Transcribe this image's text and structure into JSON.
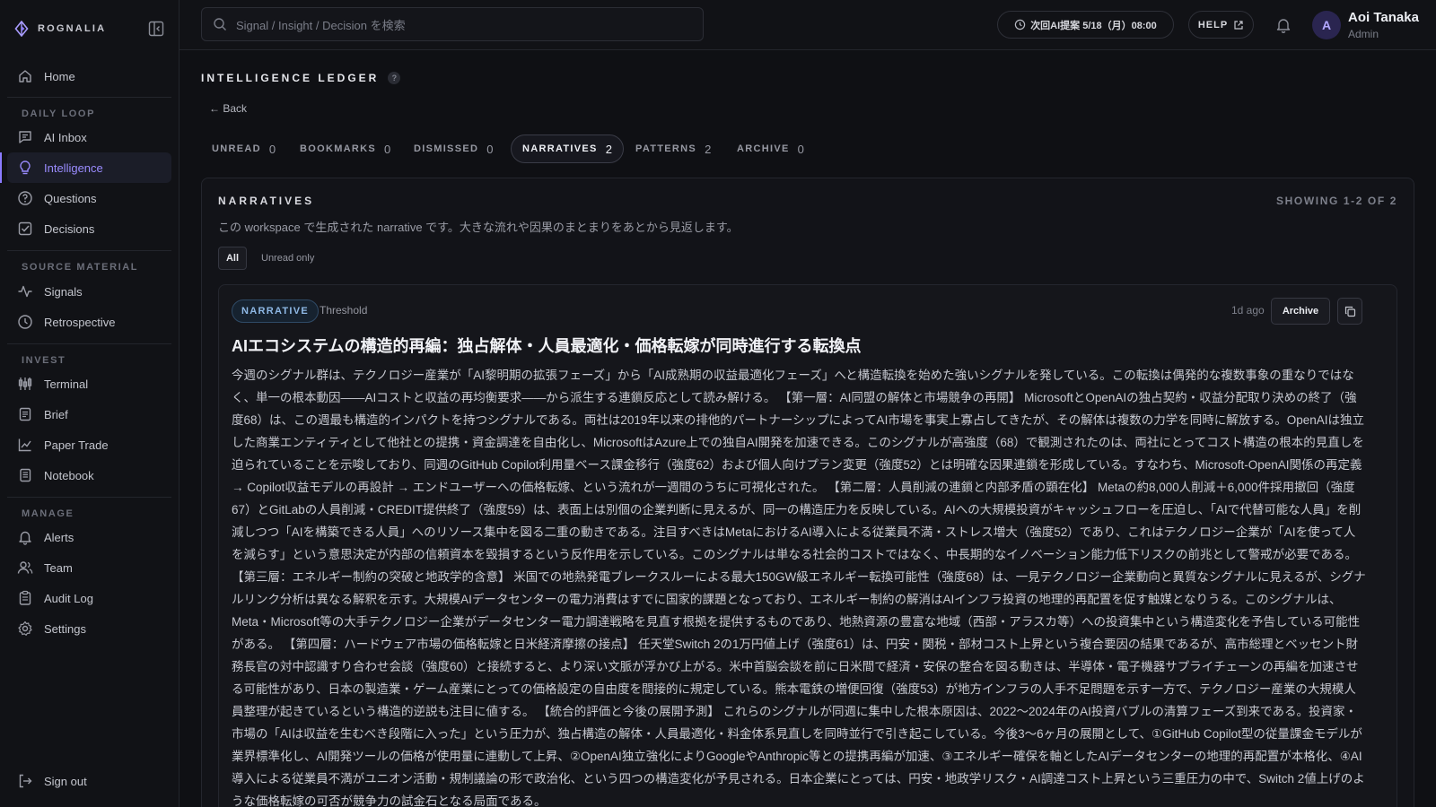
{
  "brand": {
    "name": "ROGNALIA"
  },
  "nav": {
    "home": "Home",
    "sections": {
      "daily_loop": "DAILY LOOP",
      "source_material": "SOURCE MATERIAL",
      "invest": "INVEST",
      "manage": "MANAGE"
    },
    "items": {
      "ai_inbox": "AI Inbox",
      "intelligence": "Intelligence",
      "questions": "Questions",
      "decisions": "Decisions",
      "signals": "Signals",
      "retrospective": "Retrospective",
      "terminal": "Terminal",
      "brief": "Brief",
      "paper_trade": "Paper Trade",
      "notebook": "Notebook",
      "alerts": "Alerts",
      "team": "Team",
      "audit_log": "Audit Log",
      "settings": "Settings"
    },
    "sign_out": "Sign out",
    "active_item": "intelligence"
  },
  "topbar": {
    "search_placeholder": "Signal / Insight / Decision を検索",
    "next_proposal": "次回AI提案 5/18（月）08:00",
    "help": "HELP",
    "user_initial": "A",
    "user_name": "Aoi Tanaka",
    "user_role": "Admin"
  },
  "page": {
    "title": "INTELLIGENCE LEDGER",
    "help_glyph": "?",
    "back": "← Back"
  },
  "tabs": [
    {
      "label": "UNREAD",
      "count": "0"
    },
    {
      "label": "BOOKMARKS",
      "count": "0"
    },
    {
      "label": "DISMISSED",
      "count": "0"
    },
    {
      "label": "NARRATIVES",
      "count": "2",
      "active": true
    },
    {
      "label": "PATTERNS",
      "count": "2"
    },
    {
      "label": "ARCHIVE",
      "count": "0"
    }
  ],
  "panel": {
    "title": "NARRATIVES",
    "description": "この workspace で生成された narrative です。大きな流れや因果のまとまりをあとから見返します。",
    "showing": "SHOWING 1-2 OF 2",
    "filters": {
      "all": "All",
      "unread_only": "Unread only"
    }
  },
  "card": {
    "badge": "NARRATIVE",
    "trigger": "Threshold",
    "age": "1d ago",
    "archive": "Archive",
    "title": "AIエコシステムの構造的再編：独占解体・人員最適化・価格転嫁が同時進行する転換点",
    "body": "今週のシグナル群は、テクノロジー産業が「AI黎明期の拡張フェーズ」から「AI成熟期の収益最適化フェーズ」へと構造転換を始めた強いシグナルを発している。この転換は偶発的な複数事象の重なりではなく、単一の根本動因——AIコストと収益の再均衡要求——から派生する連鎖反応として読み解ける。 【第一層：AI同盟の解体と市場競争の再開】 MicrosoftとOpenAIの独占契約・収益分配取り決めの終了（強度68）は、この週最も構造的インパクトを持つシグナルである。両社は2019年以来の排他的パートナーシップによってAI市場を事実上寡占してきたが、その解体は複数の力学を同時に解放する。OpenAIは独立した商業エンティティとして他社との提携・資金調達を自由化し、MicrosoftはAzure上での独自AI開発を加速できる。このシグナルが高強度（68）で観測されたのは、両社にとってコスト構造の根本的見直しを迫られていることを示唆しており、同週のGitHub Copilot利用量ベース課金移行（強度62）および個人向けプラン変更（強度52）とは明確な因果連鎖を形成している。すなわち、Microsoft-OpenAI関係の再定義 → Copilot収益モデルの再設計 → エンドユーザーへの価格転嫁、という流れが一週間のうちに可視化された。 【第二層：人員削減の連鎖と内部矛盾の顕在化】 Metaの約8,000人削減＋6,000件採用撤回（強度67）とGitLabの人員削減・CREDIT提供終了（強度59）は、表面上は別個の企業判断に見えるが、同一の構造圧力を反映している。AIへの大規模投資がキャッシュフローを圧迫し、「AIで代替可能な人員」を削減しつつ「AIを構築できる人員」へのリソース集中を図る二重の動きである。注目すべきはMetaにおけるAI導入による従業員不満・ストレス増大（強度52）であり、これはテクノロジー企業が「AIを使って人を減らす」という意思決定が内部の信頼資本を毀損するという反作用を示している。このシグナルは単なる社会的コストではなく、中長期的なイノベーション能力低下リスクの前兆として警戒が必要である。 【第三層：エネルギー制約の突破と地政学的含意】 米国での地熱発電ブレークスルーによる最大150GW級エネルギー転換可能性（強度68）は、一見テクノロジー企業動向と異質なシグナルに見えるが、シグナルリンク分析は異なる解釈を示す。大規模AIデータセンターの電力消費はすでに国家的課題となっており、エネルギー制約の解消はAIインフラ投資の地理的再配置を促す触媒となりうる。このシグナルは、Meta・Microsoft等の大手テクノロジー企業がデータセンター電力調達戦略を見直す根拠を提供するものであり、地熱資源の豊富な地域（西部・アラスカ等）への投資集中という構造変化を予告している可能性がある。 【第四層：ハードウェア市場の価格転嫁と日米経済摩擦の接点】 任天堂Switch 2の1万円値上げ（強度61）は、円安・関税・部材コスト上昇という複合要因の結果であるが、高市総理とベッセント財務長官の対中認識すり合わせ会談（強度60）と接続すると、より深い文脈が浮かび上がる。米中首脳会談を前に日米間で経済・安保の整合を図る動きは、半導体・電子機器サプライチェーンの再編を加速させる可能性があり、日本の製造業・ゲーム産業にとっての価格設定の自由度を間接的に規定している。熊本電鉄の増便回復（強度53）が地方インフラの人手不足問題を示す一方で、テクノロジー産業の大規模人員整理が起きているという構造的逆説も注目に値する。 【統合的評価と今後の展開予測】 これらのシグナルが同週に集中した根本原因は、2022〜2024年のAI投資バブルの清算フェーズ到来である。投資家・市場の「AIは収益を生むべき段階に入った」という圧力が、独占構造の解体・人員最適化・料金体系見直しを同時並行で引き起こしている。今後3〜6ヶ月の展開として、①GitHub Copilot型の従量課金モデルが業界標準化し、AI開発ツールの価格が使用量に連動して上昇、②OpenAI独立強化によりGoogleやAnthropic等との提携再編が加速、③エネルギー確保を軸としたAIデータセンターの地理的再配置が本格化、④AI導入による従業員不満がユニオン活動・規制議論の形で政治化、という四つの構造変化が予見される。日本企業にとっては、円安・地政学リスク・AI調達コスト上昇という三重圧力の中で、Switch 2値上げのような価格転嫁の可否が競争力の試金石となる局面である。"
  },
  "colors": {
    "accent": "#8b7bff",
    "background": "#0f1014",
    "panel": "#121318",
    "badge_text": "#8fb9e6"
  }
}
